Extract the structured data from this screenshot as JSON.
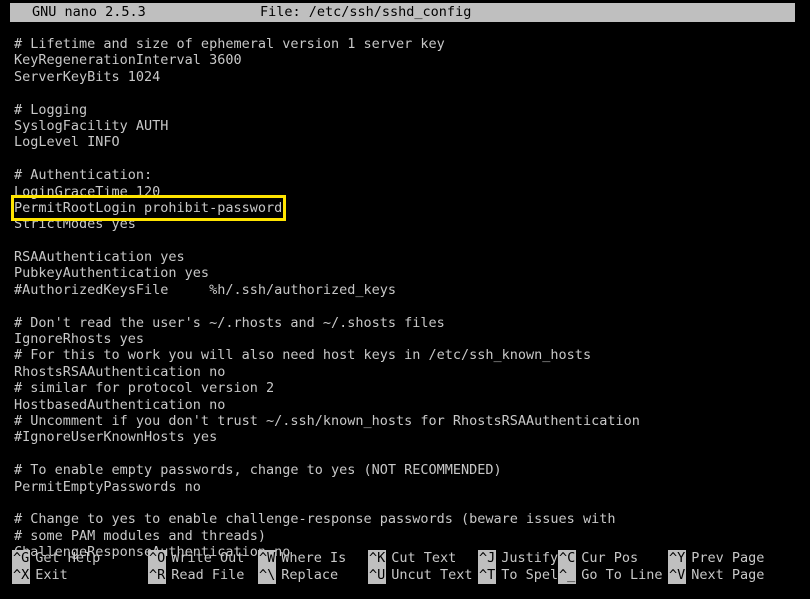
{
  "titlebar": {
    "app": "GNU nano 2.5.3",
    "file": "File: /etc/ssh/sshd_config"
  },
  "editor": {
    "filename": "/etc/ssh/sshd_config",
    "lines": [
      "# Lifetime and size of ephemeral version 1 server key",
      "KeyRegenerationInterval 3600",
      "ServerKeyBits 1024",
      "",
      "# Logging",
      "SyslogFacility AUTH",
      "LogLevel INFO",
      "",
      "# Authentication:",
      "LoginGraceTime 120",
      "PermitRootLogin prohibit-password",
      "StrictModes yes",
      "",
      "RSAAuthentication yes",
      "PubkeyAuthentication yes",
      "#AuthorizedKeysFile     %h/.ssh/authorized_keys",
      "",
      "# Don't read the user's ~/.rhosts and ~/.shosts files",
      "IgnoreRhosts yes",
      "# For this to work you will also need host keys in /etc/ssh_known_hosts",
      "RhostsRSAAuthentication no",
      "# similar for protocol version 2",
      "HostbasedAuthentication no",
      "# Uncomment if you don't trust ~/.ssh/known_hosts for RhostsRSAAuthentication",
      "#IgnoreUserKnownHosts yes",
      "",
      "# To enable empty passwords, change to yes (NOT RECOMMENDED)",
      "PermitEmptyPasswords no",
      "",
      "# Change to yes to enable challenge-response passwords (beware issues with",
      "# some PAM modules and threads)",
      "ChallengeResponseAuthentication no"
    ]
  },
  "annotation": {
    "highlight_color": "#ffe400",
    "highlighted_text": "PermitRootLogin prohibit-password",
    "highlighted_line_index": 10
  },
  "shortcuts": {
    "columns": [
      {
        "top": {
          "key": "^G",
          "label": "Get Help"
        },
        "bottom": {
          "key": "^X",
          "label": "Exit"
        }
      },
      {
        "top": {
          "key": "^O",
          "label": "Write Out"
        },
        "bottom": {
          "key": "^R",
          "label": "Read File"
        }
      },
      {
        "top": {
          "key": "^W",
          "label": "Where Is"
        },
        "bottom": {
          "key": "^\\",
          "label": "Replace"
        }
      },
      {
        "top": {
          "key": "^K",
          "label": "Cut Text"
        },
        "bottom": {
          "key": "^U",
          "label": "Uncut Text"
        }
      },
      {
        "top": {
          "key": "^J",
          "label": "Justify"
        },
        "bottom": {
          "key": "^T",
          "label": "To Spell"
        }
      },
      {
        "top": {
          "key": "^C",
          "label": "Cur Pos"
        },
        "bottom": {
          "key": "^_",
          "label": "Go To Line"
        }
      },
      {
        "top": {
          "key": "^Y",
          "label": "Prev Page"
        },
        "bottom": {
          "key": "^V",
          "label": "Next Page"
        }
      }
    ]
  },
  "theme": {
    "background": "#000000",
    "foreground": "#c8c8c8",
    "bar_background": "#bfbfbf",
    "bar_foreground": "#000000"
  }
}
